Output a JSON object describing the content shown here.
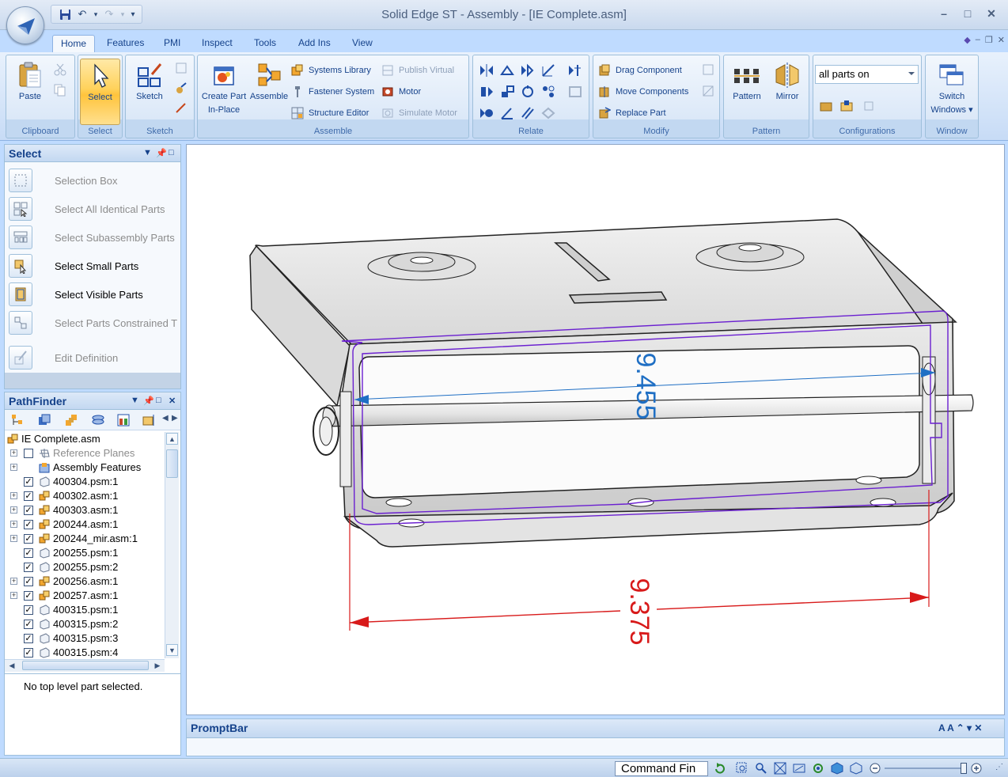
{
  "window": {
    "title": "Solid Edge ST - Assembly - [IE Complete.asm]",
    "controls": {
      "minimize": "–",
      "maximize": "□",
      "close": "✕"
    }
  },
  "quick_access": {
    "more": "▾"
  },
  "ribbon_tabs": [
    "Home",
    "Features",
    "PMI",
    "Inspect",
    "Tools",
    "Add Ins",
    "View"
  ],
  "active_tab": "Home",
  "ribbon": {
    "clipboard": {
      "paste": "Paste",
      "label": "Clipboard"
    },
    "select": {
      "select": "Select",
      "label": "Select"
    },
    "sketch": {
      "sketch": "Sketch",
      "label": "Sketch"
    },
    "assemble": {
      "create_part_1": "Create Part",
      "create_part_2": "In-Place",
      "assemble": "Assemble",
      "systems_library": "Systems Library",
      "fastener_system": "Fastener System",
      "structure_editor": "Structure Editor",
      "publish_virtual": "Publish Virtual",
      "motor": "Motor",
      "simulate_motor": "Simulate Motor",
      "label": "Assemble"
    },
    "relate": {
      "label": "Relate"
    },
    "modify": {
      "drag_component": "Drag Component",
      "move_components": "Move Components",
      "replace_part": "Replace Part",
      "label": "Modify"
    },
    "pattern": {
      "pattern": "Pattern",
      "mirror": "Mirror",
      "label": "Pattern"
    },
    "configurations": {
      "selected": "all parts on",
      "label": "Configurations"
    },
    "window": {
      "switch_1": "Switch",
      "switch_2": "Windows ▾",
      "label": "Window"
    }
  },
  "select_panel": {
    "title": "Select",
    "items": [
      {
        "label": "Selection Box",
        "enabled": false
      },
      {
        "label": "Select All Identical Parts",
        "enabled": false
      },
      {
        "label": "Select Subassembly Parts",
        "enabled": false
      },
      {
        "label": "Select Small Parts",
        "enabled": true
      },
      {
        "label": "Select Visible Parts",
        "enabled": true
      },
      {
        "label": "Select Parts Constrained T",
        "enabled": false
      },
      {
        "label": "Edit Definition",
        "enabled": false
      }
    ]
  },
  "pathfinder": {
    "title": "PathFinder",
    "tree": [
      {
        "label": "IE Complete.asm",
        "type": "root"
      },
      {
        "label": "Reference Planes",
        "type": "planes",
        "expand": true,
        "checked": false,
        "dim": true
      },
      {
        "label": "Assembly Features",
        "type": "features",
        "expand": true
      },
      {
        "label": "400304.psm:1",
        "type": "part",
        "checked": true
      },
      {
        "label": "400302.asm:1",
        "type": "asm",
        "expand": true,
        "checked": true
      },
      {
        "label": "400303.asm:1",
        "type": "asm",
        "expand": true,
        "checked": true
      },
      {
        "label": "200244.asm:1",
        "type": "asm",
        "expand": true,
        "checked": true
      },
      {
        "label": "200244_mir.asm:1",
        "type": "asm",
        "expand": true,
        "checked": true
      },
      {
        "label": "200255.psm:1",
        "type": "part",
        "checked": true
      },
      {
        "label": "200255.psm:2",
        "type": "part",
        "checked": true
      },
      {
        "label": "200256.asm:1",
        "type": "asm",
        "expand": true,
        "checked": true
      },
      {
        "label": "200257.asm:1",
        "type": "asm",
        "expand": true,
        "checked": true
      },
      {
        "label": "400315.psm:1",
        "type": "part",
        "checked": true
      },
      {
        "label": "400315.psm:2",
        "type": "part",
        "checked": true
      },
      {
        "label": "400315.psm:3",
        "type": "part",
        "checked": true
      },
      {
        "label": "400315.psm:4",
        "type": "part",
        "checked": true
      }
    ],
    "status": "No top level part selected."
  },
  "viewport": {
    "dimensions": [
      {
        "value": "9.455",
        "color": "#1f6fc4"
      },
      {
        "value": "9.375",
        "color": "#d81a1a"
      }
    ]
  },
  "promptbar": {
    "title": "PromptBar",
    "controls": "A A ⌃ ▾ ✕"
  },
  "statusbar": {
    "command_finder": "Command Fin"
  },
  "colors": {
    "ribbon": "#d1e2f8",
    "accent": "#15428b",
    "highlight": "#ffd25c",
    "selection": "#6a1fd0"
  }
}
